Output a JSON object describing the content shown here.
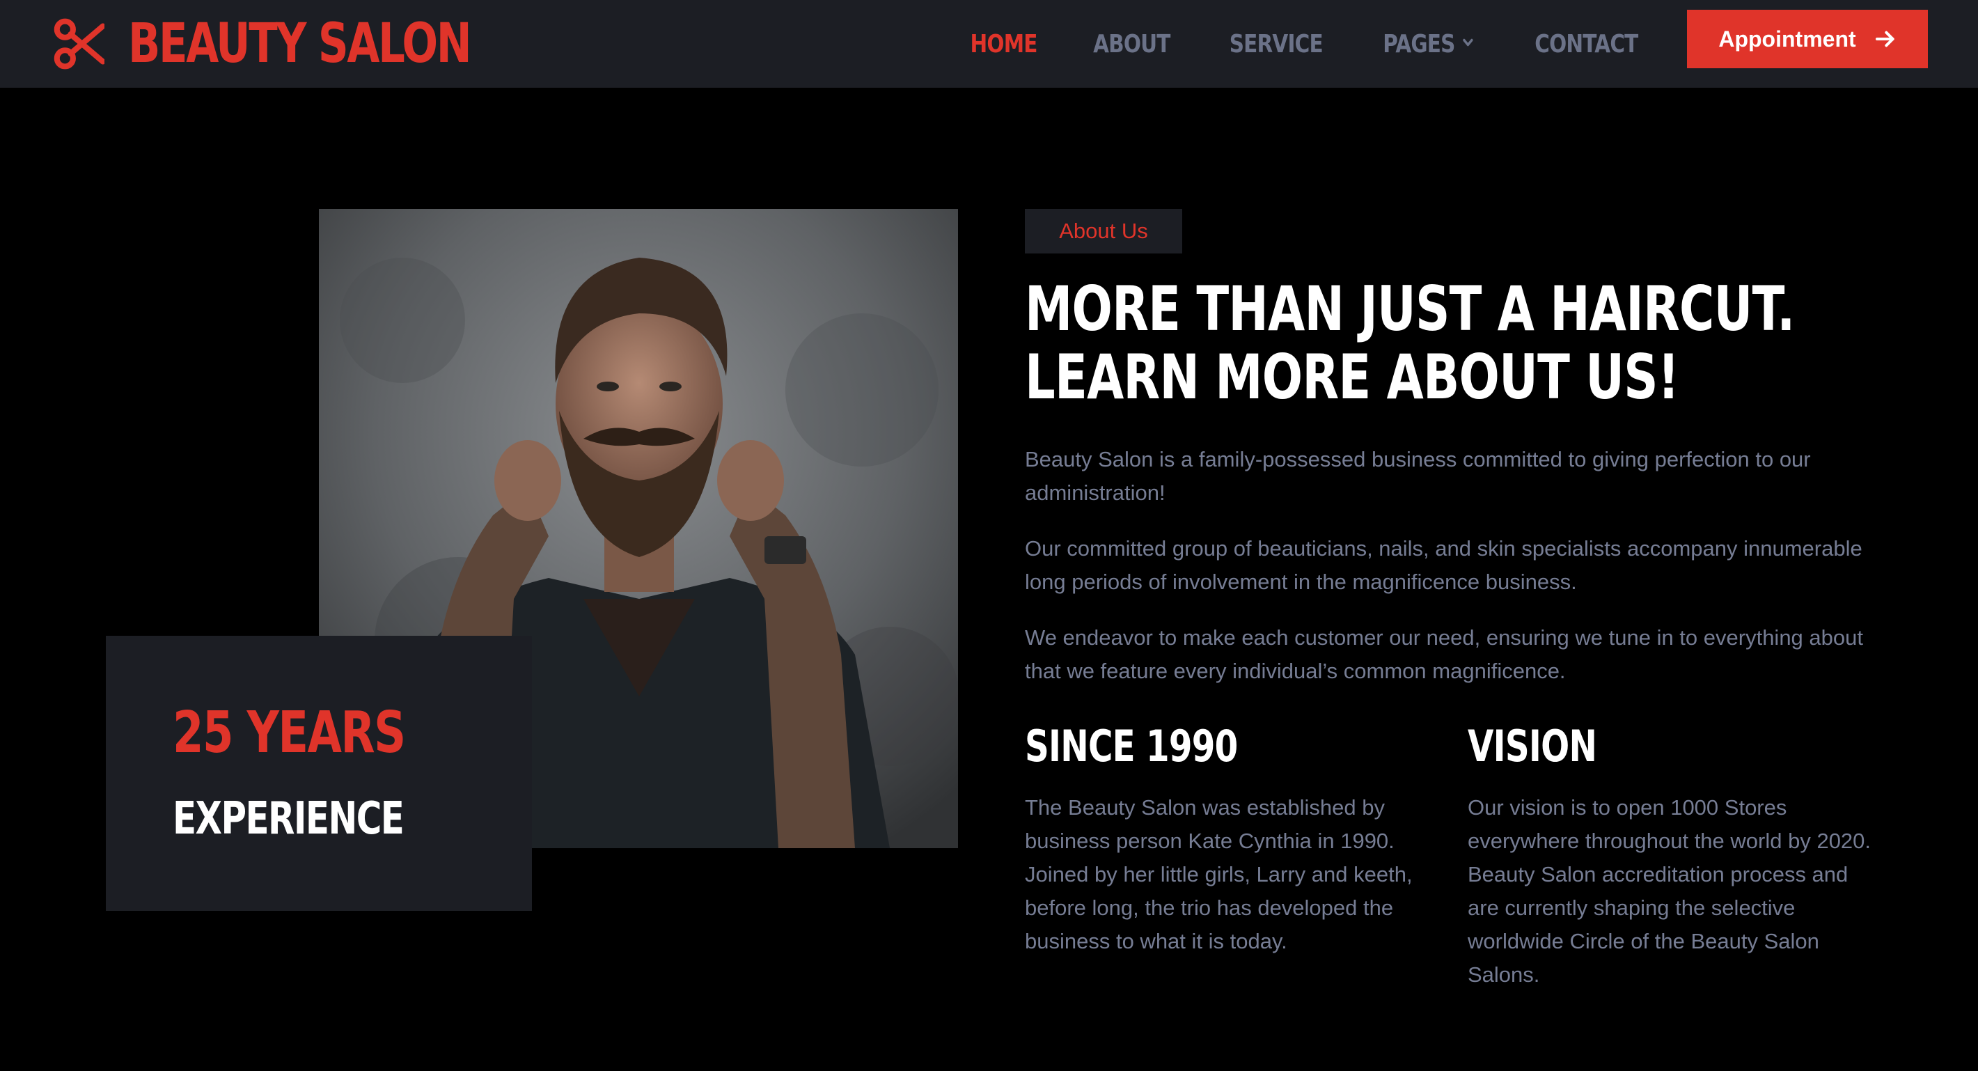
{
  "brand": {
    "name": "BEAUTY SALON",
    "icon": "scissors-icon",
    "color": "#e0342a"
  },
  "nav": {
    "items": [
      {
        "label": "HOME",
        "active": true
      },
      {
        "label": "ABOUT",
        "active": false
      },
      {
        "label": "SERVICE",
        "active": false
      },
      {
        "label": "PAGES",
        "active": false,
        "dropdown": true
      },
      {
        "label": "CONTACT",
        "active": false
      }
    ],
    "cta_label": "Appointment",
    "cta_icon": "arrow-right-icon"
  },
  "photo": {
    "alt_subject": "bearded-man-portrait"
  },
  "experience": {
    "years": "25 YEARS",
    "label": "EXPERIENCE"
  },
  "about": {
    "tag": "About Us",
    "headline": "MORE THAN JUST A HAIRCUT. LEARN MORE ABOUT US!",
    "paragraphs": [
      "Beauty Salon is a family-possessed business committed to giving perfection to our administration!",
      "Our committed group of beauticians, nails, and skin specialists accompany innumerable long periods of involvement in the magnificence business.",
      "We endeavor to make each customer our need, ensuring we tune in to everything about that we feature every individual’s common magnificence."
    ],
    "columns": [
      {
        "title": "SINCE 1990",
        "text": "The Beauty Salon was established by business person Kate Cynthia in 1990. Joined by her little girls, Larry and keeth, before long, the trio has developed the business to what it is today."
      },
      {
        "title": "VISION",
        "text": "Our vision is to open 1000 Stores everywhere throughout the world by 2020. Beauty Salon accreditation process and are currently shaping the selective worldwide Circle of the Beauty Salon Salons."
      }
    ]
  },
  "colors": {
    "accent": "#e0342a",
    "nav_bg": "#1c1e24",
    "page_bg": "#000000",
    "muted_text": "#767d94",
    "nav_text": "#6b7288"
  }
}
